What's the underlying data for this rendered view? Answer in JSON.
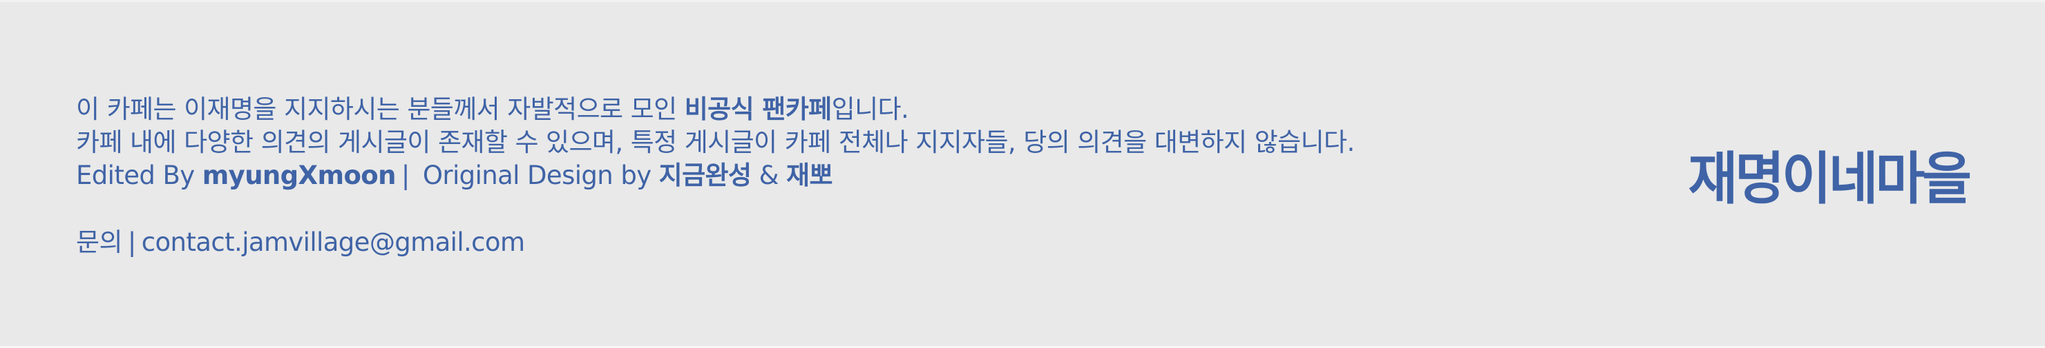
{
  "footer": {
    "intro_before": "이 카페는 이재명을 지지하시는 분들께서 자발적으로 모인 ",
    "intro_bold": "비공식 팬카페",
    "intro_after": "입니다.",
    "disclaimer": "카페 내에 다양한 의견의 게시글이 존재할 수 있으며, 특정 게시글이 카페 전체나 지지자들, 당의 의견을 대변하지 않습니다.",
    "credits": {
      "edited_by_label": "Edited By ",
      "editor": "myungXmoon",
      "separator": "|",
      "design_label": " Original Design by ",
      "designer_1": "지금완성",
      "ampersand": " & ",
      "designer_2": "재뽀"
    },
    "contact": {
      "label": "문의",
      "separator": "|",
      "email": "contact.jamvillage@gmail.com"
    },
    "logo_text": "재명이네마을",
    "colors": {
      "background": "#e9e9e9",
      "accent": "#3f63a6"
    }
  }
}
